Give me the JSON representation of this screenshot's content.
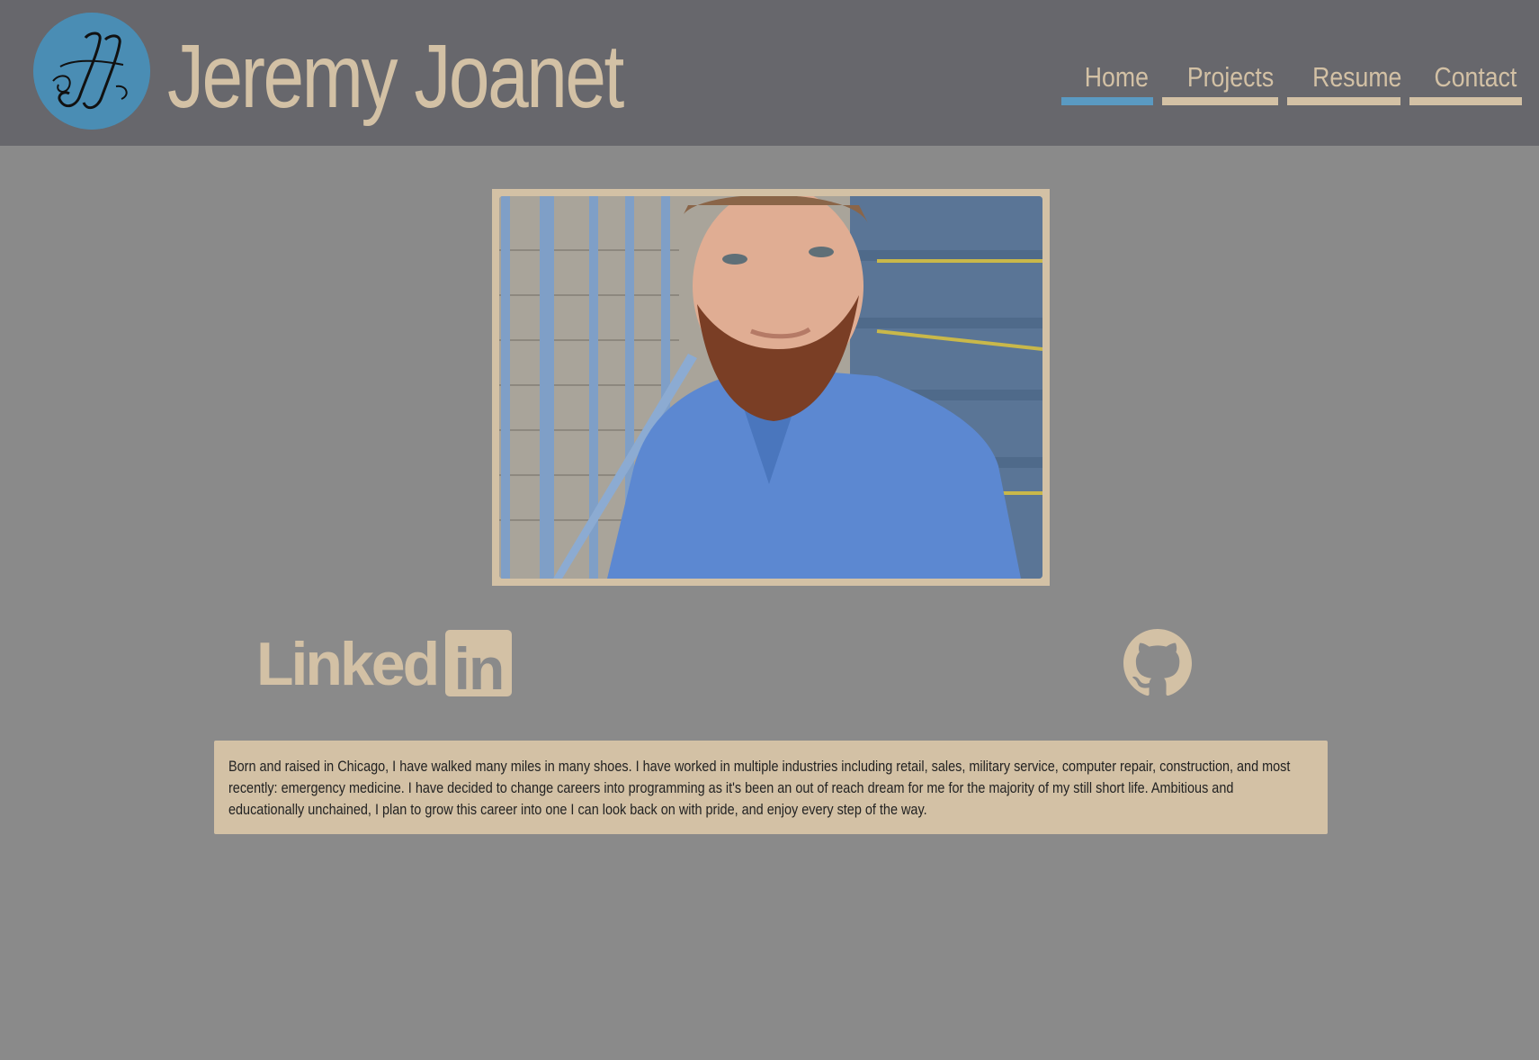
{
  "header": {
    "logo_icon": "jj-monogram-logo",
    "title": "Jeremy Joanet"
  },
  "nav": {
    "items": [
      {
        "label": "Home",
        "active": true
      },
      {
        "label": "Projects",
        "active": false
      },
      {
        "label": "Resume",
        "active": false
      },
      {
        "label": "Contact",
        "active": false
      }
    ]
  },
  "main": {
    "photo_icon": "profile-photo",
    "social": {
      "linkedin": {
        "word": "Linked",
        "box": "in",
        "icon": "linkedin-icon"
      },
      "github": {
        "icon": "github-icon"
      }
    },
    "bio": "Born and raised in Chicago, I have walked many miles in many shoes. I have worked in multiple industries including retail, sales, military service, computer repair, construction, and most recently: emergency medicine. I have decided to change careers into programming as it's been an out of reach dream for me for the majority of my still short life. Ambitious and educationally unchained, I plan to grow this career into one I can look back on with pride, and enjoy every step of the way."
  },
  "colors": {
    "header_bg": "#67676c",
    "page_bg": "#8a8a8a",
    "accent_tan": "#d3c1a5",
    "active_blue": "#5a9ac2",
    "logo_blue": "#4a8db4"
  }
}
